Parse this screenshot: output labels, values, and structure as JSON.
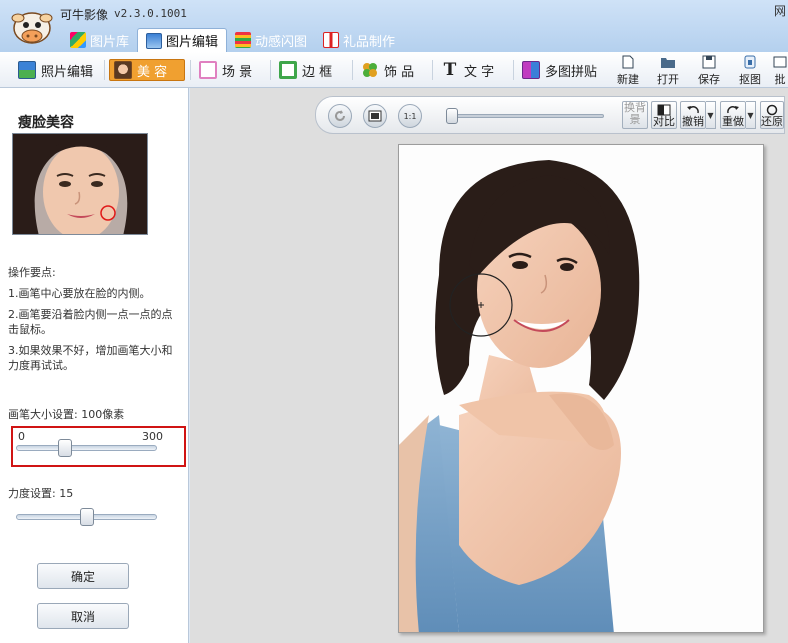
{
  "app": {
    "title": "可牛影像",
    "version": "v2.3.0.1001",
    "corner_text": "网"
  },
  "tabs": [
    {
      "label": "图片库",
      "active": false
    },
    {
      "label": "图片编辑",
      "active": true
    },
    {
      "label": "动感闪图",
      "active": false
    },
    {
      "label": "礼品制作",
      "active": false
    }
  ],
  "toolbar": {
    "items": [
      {
        "label": "照片编辑"
      },
      {
        "label": "美 容",
        "active": true
      },
      {
        "label": "场 景"
      },
      {
        "label": "边 框"
      },
      {
        "label": "饰 品"
      },
      {
        "label": "文 字"
      },
      {
        "label": "多图拼贴"
      }
    ],
    "actions": [
      {
        "label": "新建"
      },
      {
        "label": "打开"
      },
      {
        "label": "保存"
      },
      {
        "label": "抠图"
      },
      {
        "label": "批"
      }
    ]
  },
  "panel": {
    "title": "瘦脸美容",
    "tips_heading": "操作要点:",
    "tips": [
      "1.画笔中心要放在脸的内侧。",
      "2.画笔要沿着脸内侧一点一点的点击鼠标。",
      "3.如果效果不好，增加画笔大小和力度再试试。"
    ],
    "brush_size_label": "画笔大小设置: 100像素",
    "brush_size": {
      "min": "0",
      "max": "300",
      "value": 100
    },
    "strength_label": "力度设置: 15",
    "strength": {
      "value": 15
    },
    "confirm_label": "确定",
    "cancel_label": "取消"
  },
  "imagebar": {
    "zoom_1to1_label": "1:1",
    "buttons": [
      {
        "label": "换背景",
        "disabled": true
      },
      {
        "label": "对比"
      },
      {
        "label": "撤销"
      },
      {
        "label": "重做"
      },
      {
        "label": "还原"
      }
    ]
  },
  "colors": {
    "accent": "#f0a030",
    "highlight_border": "#d01414",
    "tab_bar": "#b4d0ee"
  }
}
